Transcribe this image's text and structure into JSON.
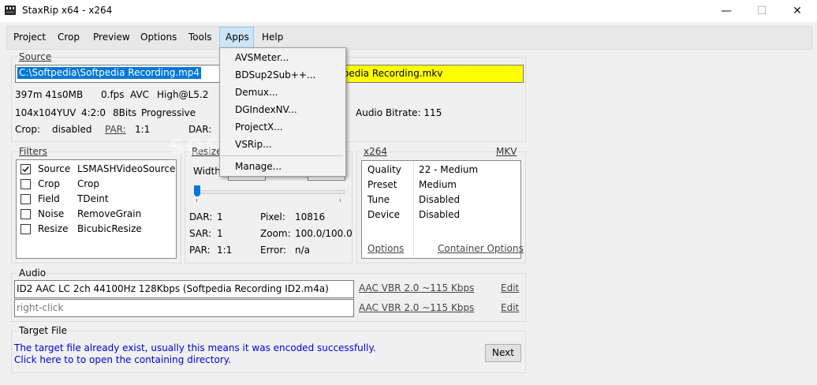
{
  "window": {
    "title": "StaxRip x64 - x264",
    "minimize": "—",
    "maximize": "☐",
    "close": "✕"
  },
  "menu": [
    "Project",
    "Crop",
    "Preview",
    "Options",
    "Tools",
    "Apps",
    "Help"
  ],
  "apps_menu": [
    "AVSMeter...",
    "BDSup2Sub++...",
    "Demux...",
    "DGIndexNV...",
    "ProjectX...",
    "VSRip...",
    "Manage..."
  ],
  "source": {
    "label": "Source",
    "path": "C:\\Softpedia\\Softpedia Recording.mp4",
    "target_visible": "ftpedia Recording.mkv",
    "info_row1": [
      "397m 41s",
      "0MB",
      "0.fps",
      "AVC",
      "High@L5.2"
    ],
    "info_row2": [
      "104x104",
      "YUV",
      "4:2:0",
      "8Bits",
      "Progressive"
    ],
    "crop_label": "Crop:",
    "crop_value": "disabled",
    "par_label": "PAR:",
    "par_value": "1:1",
    "dar_label": "DAR:",
    "audio_bitrate": "Audio Bitrate: 115"
  },
  "filters": {
    "label": "Filters",
    "items": [
      {
        "checked": true,
        "name": "Source",
        "value": "LSMASHVideoSource"
      },
      {
        "checked": false,
        "name": "Crop",
        "value": "Crop"
      },
      {
        "checked": false,
        "name": "Field",
        "value": "TDeint"
      },
      {
        "checked": false,
        "name": "Noise",
        "value": "RemoveGrain"
      },
      {
        "checked": false,
        "name": "Resize",
        "value": "BicubicResize"
      }
    ]
  },
  "resize": {
    "label": "Resize",
    "width_label": "Width",
    "slider_position": 0.0,
    "dar_label": "DAR:",
    "dar_value": "1",
    "pixel_label": "Pixel:",
    "pixel_value": "10816",
    "sar_label": "SAR:",
    "sar_value": "1",
    "zoom_label": "Zoom:",
    "zoom_value": "100.0/100.0",
    "par_label": "PAR:",
    "par_value": "1:1",
    "error_label": "Error:",
    "error_value": "n/a"
  },
  "encoder": {
    "label": "x264",
    "container_label": "MKV",
    "rows": [
      {
        "name": "Quality",
        "value": "22 - Medium"
      },
      {
        "name": "Preset",
        "value": "Medium"
      },
      {
        "name": "Tune",
        "value": "Disabled"
      },
      {
        "name": "Device",
        "value": "Disabled"
      }
    ],
    "options_link": "Options",
    "container_options_link": "Container Options"
  },
  "audio": {
    "label": "Audio",
    "track1": "ID2 AAC LC 2ch 44100Hz 128Kbps (Softpedia Recording ID2.m4a)",
    "track1_profile": "AAC VBR 2.0 ~115 Kbps",
    "track2_placeholder": "right-click",
    "track2_profile": "AAC VBR 2.0 ~115 Kbps",
    "edit": "Edit"
  },
  "target": {
    "label": "Target File",
    "line1": "The target file already exist, usually this means it was encoded successfully.",
    "line2": "Click here to to open the containing directory.",
    "next_button": "Next"
  },
  "watermark": "SOFTPEDIA®",
  "colors": {
    "highlight": "#0078d7",
    "target_bg": "#ffff00",
    "link_blue": "#0000dd"
  }
}
